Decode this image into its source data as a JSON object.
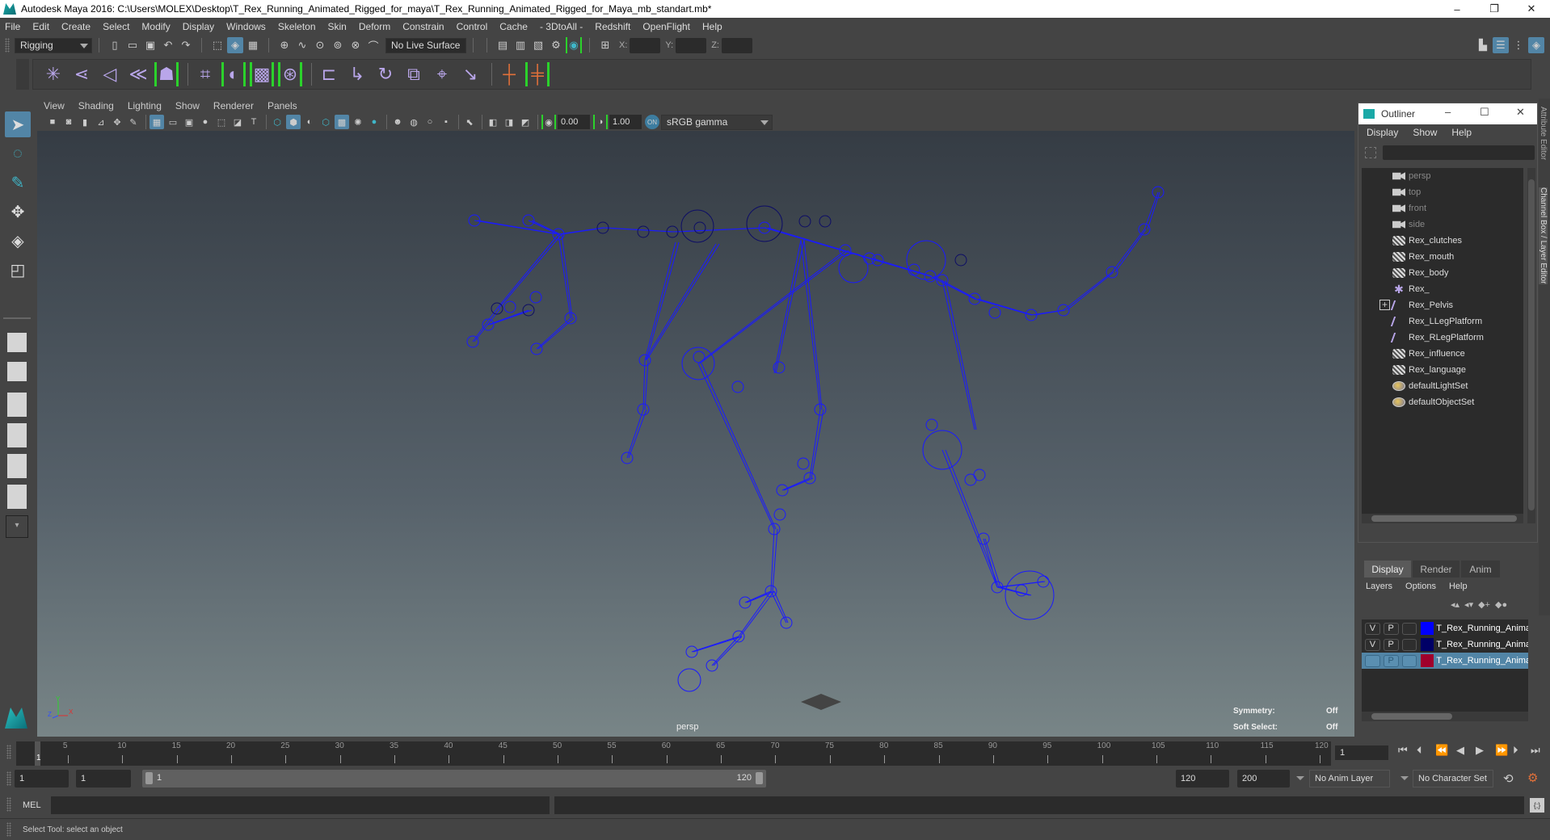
{
  "window": {
    "title": "Autodesk Maya 2016: C:\\Users\\MOLEX\\Desktop\\T_Rex_Running_Animated_Rigged_for_maya\\T_Rex_Running_Animated_Rigged_for_Maya_mb_standart.mb*",
    "minimize": "–",
    "restore": "❐",
    "close": "✕"
  },
  "menubar": [
    "File",
    "Edit",
    "Create",
    "Select",
    "Modify",
    "Display",
    "Windows",
    "Skeleton",
    "Skin",
    "Deform",
    "Constrain",
    "Control",
    "Cache",
    "- 3DtoAll -",
    "Redshift",
    "OpenFlight",
    "Help"
  ],
  "statusline": {
    "menuset": "Rigging",
    "live_surface": "No Live Surface",
    "coord_labels": {
      "x": "X:",
      "y": "Y:",
      "z": "Z:"
    }
  },
  "shelf": {
    "icons": [
      "create-joints",
      "insert-joint",
      "mirror-joint",
      "ik-handle",
      "quick-rig",
      "bind-skin",
      "paint-skin-weights",
      "smooth-bind",
      "interactive-bind",
      "parent-constraint",
      "point-constraint",
      "orient-constraint",
      "scale-constraint",
      "aim-constraint",
      "pole-vector-constraint",
      "hik-add",
      "hik-parent"
    ]
  },
  "viewport": {
    "menu": [
      "View",
      "Shading",
      "Lighting",
      "Show",
      "Renderer",
      "Panels"
    ],
    "exposure": "0.00",
    "gamma": "1.00",
    "color_space": "sRGB gamma",
    "camera_label": "persp",
    "hud": {
      "symmetry_label": "Symmetry:",
      "symmetry_value": "Off",
      "soft_select_label": "Soft Select:",
      "soft_select_value": "Off"
    },
    "axis": {
      "x": "X",
      "y": "Y",
      "z": "Z"
    },
    "colors": {
      "joint_selected": "#1a1aff",
      "joint_dark": "#0d0d66",
      "bg_top": "#353c44",
      "bg_bottom": "#788587"
    }
  },
  "outliner": {
    "title": "Outliner",
    "menu": [
      "Display",
      "Show",
      "Help"
    ],
    "items": [
      {
        "label": "persp",
        "type": "camera",
        "dim": true
      },
      {
        "label": "top",
        "type": "camera",
        "dim": true
      },
      {
        "label": "front",
        "type": "camera",
        "dim": true
      },
      {
        "label": "side",
        "type": "camera",
        "dim": true
      },
      {
        "label": "Rex_clutches",
        "type": "mesh"
      },
      {
        "label": "Rex_mouth",
        "type": "mesh"
      },
      {
        "label": "Rex_body",
        "type": "mesh"
      },
      {
        "label": "Rex_",
        "type": "locator"
      },
      {
        "label": "Rex_Pelvis",
        "type": "joint",
        "expandable": true
      },
      {
        "label": "Rex_LLegPlatform",
        "type": "joint"
      },
      {
        "label": "Rex_RLegPlatform",
        "type": "joint"
      },
      {
        "label": "Rex_influence",
        "type": "mesh"
      },
      {
        "label": "Rex_language",
        "type": "mesh"
      },
      {
        "label": "defaultLightSet",
        "type": "set"
      },
      {
        "label": "defaultObjectSet",
        "type": "set"
      }
    ]
  },
  "sidetabs": [
    "Attribute Editor",
    "Channel Box / Layer Editor"
  ],
  "layer_editor": {
    "tabs": [
      "Display",
      "Render",
      "Anim"
    ],
    "active_tab": "Display",
    "menu": [
      "Layers",
      "Options",
      "Help"
    ],
    "layers": [
      {
        "v": "V",
        "p": "P",
        "name": "T_Rex_Running_Anima",
        "color": "#0000ff",
        "selected": false
      },
      {
        "v": "V",
        "p": "P",
        "name": "T_Rex_Running_Anima",
        "color": "#000066",
        "selected": false
      },
      {
        "v": "",
        "p": "P",
        "name": "T_Rex_Running_Anima",
        "color": "#a0002c",
        "selected": true
      }
    ]
  },
  "timeline": {
    "ticks": [
      "5",
      "10",
      "15",
      "20",
      "25",
      "30",
      "35",
      "40",
      "45",
      "50",
      "55",
      "60",
      "65",
      "70",
      "75",
      "80",
      "85",
      "90",
      "95",
      "100",
      "105",
      "110",
      "115",
      "120"
    ],
    "current_frame": "1",
    "current_frame_field": "1",
    "playback": [
      "go-to-start",
      "step-back-frame",
      "step-back-key",
      "play-backwards",
      "play-forwards",
      "step-forward-key",
      "step-forward-frame",
      "go-to-end"
    ]
  },
  "range": {
    "start": "1",
    "playback_start": "1",
    "slider_start": "1",
    "slider_end": "120",
    "playback_end": "120",
    "end": "200",
    "anim_layer": "No Anim Layer",
    "character_set": "No Character Set"
  },
  "command_line": {
    "label": "MEL",
    "value": ""
  },
  "help_line": "Select Tool: select an object"
}
